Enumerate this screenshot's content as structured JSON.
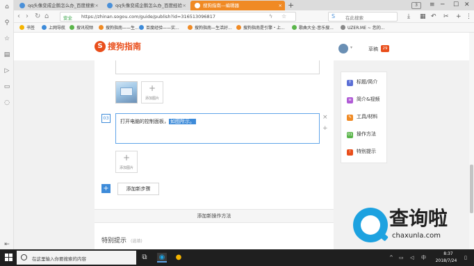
{
  "browser": {
    "tabs": [
      {
        "label": "qq头像变成企鹅怎么办_百度搜索",
        "active": false
      },
      {
        "label": "qq头像变成企鹅怎么办_百度经验",
        "active": false
      },
      {
        "label": "搜狗指南—编辑器",
        "active": true
      }
    ],
    "tab_count": "3",
    "url_secure_label": "安全",
    "url": "https://zhinan.sogou.com/guide/publish?id=316513096817",
    "search_placeholder": "在此搜索",
    "bookmarks": [
      "书签",
      "上网导航",
      "搜讯视频",
      "搜狗指南——生...",
      "百度经验——实...",
      "搜狗指南—生活好...",
      "搜狗指南是引擎・上...",
      "歌曲大全-音乐搜...",
      "UZER.ME ~ 您的..."
    ]
  },
  "site": {
    "logo_text": "搜狗指南",
    "draft_label": "草稿",
    "draft_count": "29"
  },
  "editor": {
    "add_image_label": "添加图片",
    "step_number": "03",
    "step_text": "打开电脑的控制面板，",
    "step_text_selected": "如图所示。",
    "add_step_label": "添加新步骤",
    "add_method_label": "添加新操作方法",
    "tips_title": "特别提示",
    "tips_optional": "(选填)"
  },
  "right_nav": {
    "items": [
      {
        "badge": "T",
        "label": "标题/简介",
        "color": "#5b6fd6"
      },
      {
        "badge": "≡",
        "label": "简介&视频",
        "color": "#b05bd6"
      },
      {
        "badge": "✎",
        "label": "工具/材料",
        "color": "#f08a24"
      },
      {
        "badge": "01",
        "label": "操作方法",
        "color": "#5ab54a"
      },
      {
        "badge": "!",
        "label": "特别提示",
        "color": "#e94e1b"
      }
    ]
  },
  "watermark": {
    "brand": "查询啦",
    "domain": "chaxunla.com"
  },
  "taskbar": {
    "search_placeholder": "在这里输入你要搜索的内容",
    "time": "8:37",
    "date": "2018/7/24"
  },
  "colors": {
    "accent": "#3d8bd9",
    "brand": "#e94e1b",
    "active_tab": "#f08a24"
  }
}
